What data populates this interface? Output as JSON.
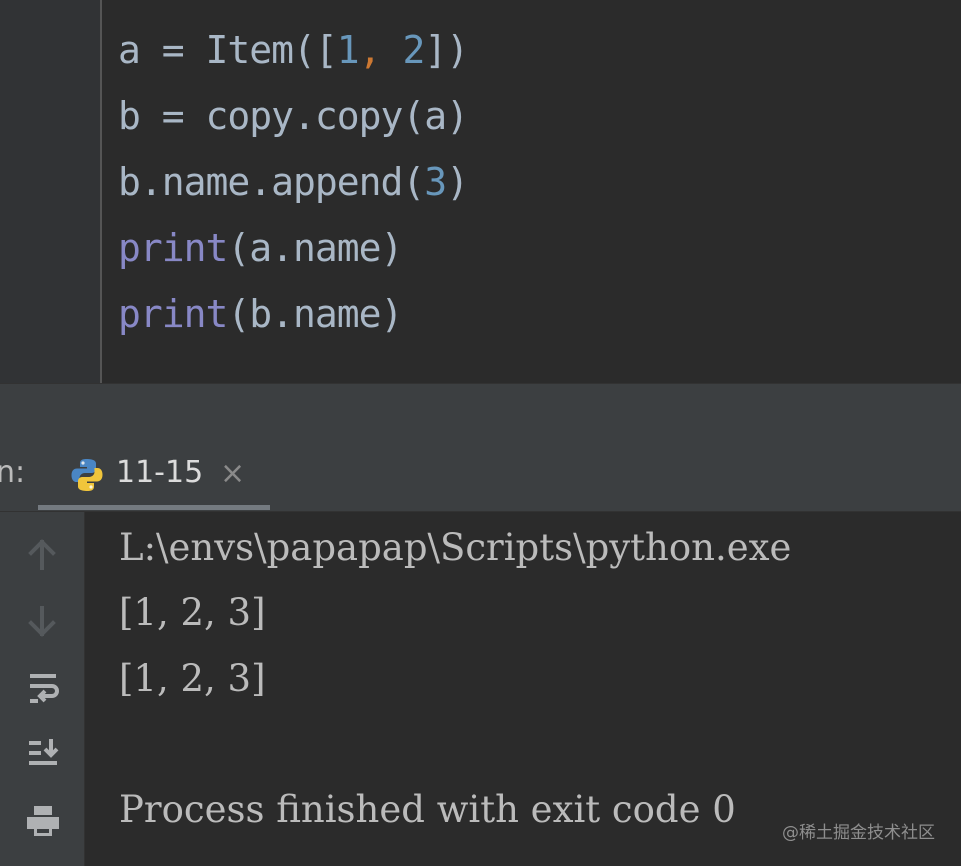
{
  "editor": {
    "lines": [
      {
        "a": "a = Item([",
        "b": "1",
        "c": ", ",
        "d": "2",
        "e": "])"
      },
      {
        "a": "b = copy.copy(a)"
      },
      {
        "a": "b.name.append(",
        "b": "3",
        "c": ")"
      },
      {
        "kw": "print",
        "rest": "(a.name)"
      },
      {
        "kw": "print",
        "rest": "(b.name)"
      }
    ]
  },
  "run": {
    "label": "n:",
    "tab_title": "11-15",
    "tab_close": "×"
  },
  "toolbar": {
    "icons": [
      "up-arrow-icon",
      "down-arrow-icon",
      "soft-wrap-icon",
      "scroll-to-end-icon",
      "print-icon"
    ]
  },
  "console": {
    "lines": [
      "L:\\envs\\papapap\\Scripts\\python.exe ",
      "[1, 2, 3]",
      "[1, 2, 3]",
      "",
      "Process finished with exit code 0"
    ]
  },
  "watermark": "@稀土掘金技术社区",
  "colors": {
    "editor_bg": "#2b2b2b",
    "gutter_bg": "#313335",
    "panel_bg": "#3c3f41",
    "text": "#a9b7c6",
    "builtin": "#8888c6",
    "number": "#6897bb",
    "comma": "#cc7832",
    "console_text": "#bbbbbb"
  }
}
